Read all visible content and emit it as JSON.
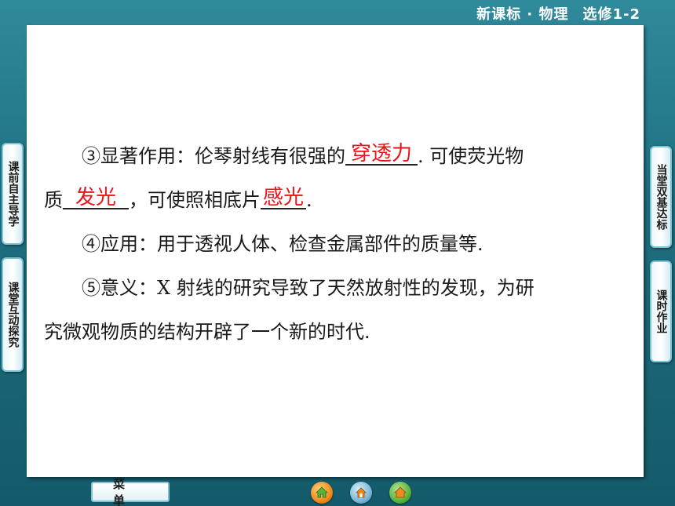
{
  "header": {
    "title": "新课标 · 物理",
    "subtitle": "选修1-2"
  },
  "content": {
    "para1": {
      "prefix": "③显著作用：伦琴射线有很强的",
      "blank1": "穿透力",
      "middle": ". 可使荧光物",
      "line2_prefix": "质",
      "blank2": "发光",
      "line2_middle": "，可使照相底片",
      "blank3": "感光",
      "line2_end": "."
    },
    "para2": "④应用：用于透视人体、检查金属部件的质量等.",
    "para3_line1": "⑤意义：X 射线的研究导致了天然放射性的发现，为研",
    "para3_line2": "究微观物质的结构开辟了一个新的时代."
  },
  "left_tabs": [
    {
      "label": "课前自主导学"
    },
    {
      "label": "课堂互动探究"
    }
  ],
  "right_tabs": [
    {
      "label": "当堂双基达标"
    },
    {
      "label": "课时作业"
    }
  ],
  "bottom": {
    "menu_label": "菜单",
    "icons": [
      "home-icon",
      "back-icon",
      "forward-icon"
    ]
  },
  "colors": {
    "background": "#1f6f80",
    "answer": "#e8141a",
    "tab_border": "#7cc3d6",
    "nav_orange": "#f08a1c",
    "nav_green": "#5ab33a"
  }
}
